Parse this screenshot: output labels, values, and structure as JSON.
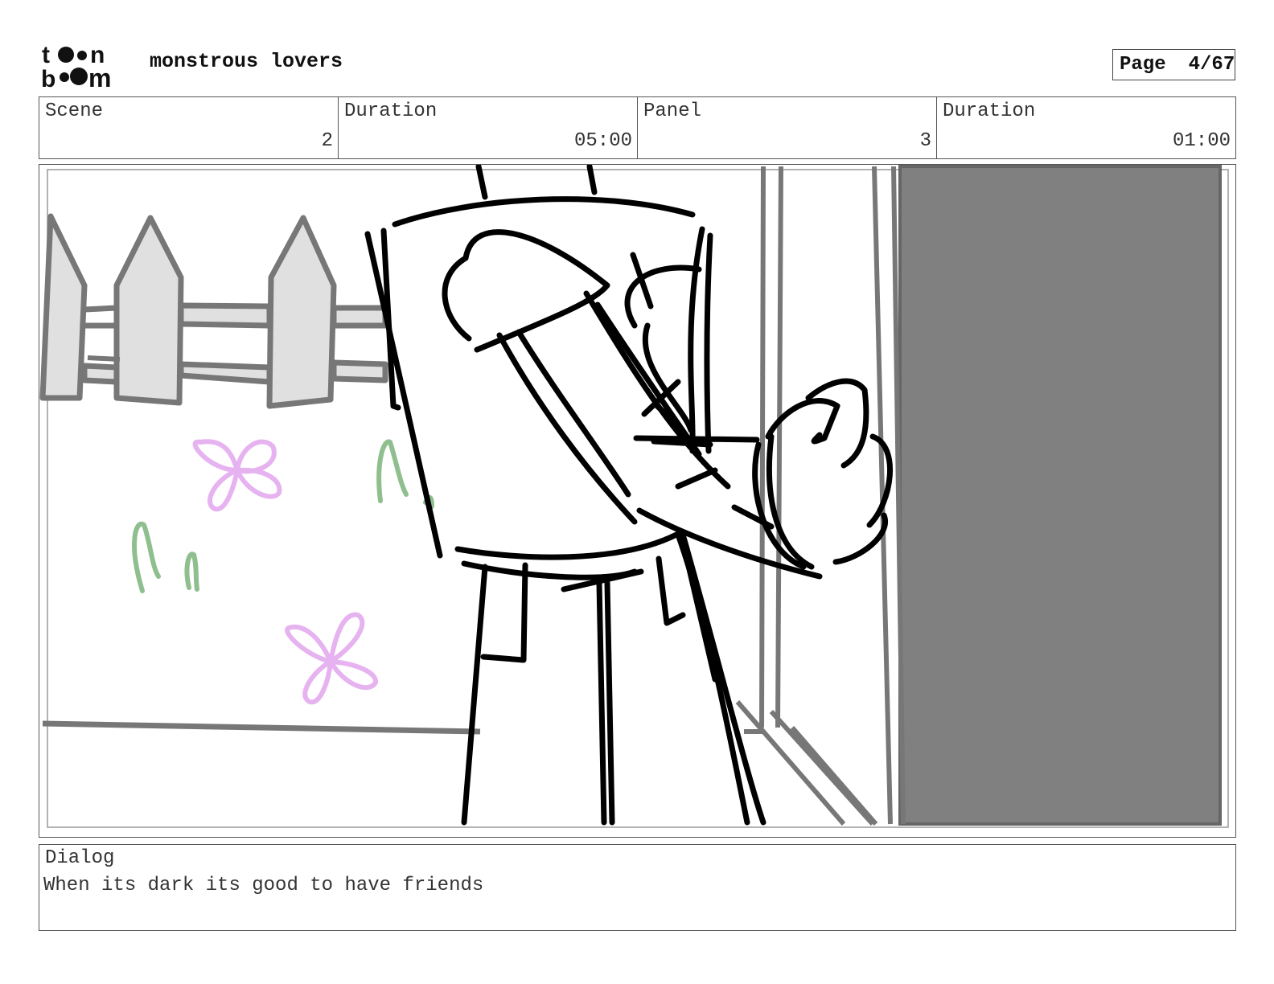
{
  "header": {
    "logo_text": "toon boom",
    "project_title": "monstrous lovers",
    "page_label": "Page",
    "page_value": "4/67"
  },
  "info": {
    "scene_label": "Scene",
    "scene_value": "2",
    "scene_duration_label": "Duration",
    "scene_duration_value": "05:00",
    "panel_label": "Panel",
    "panel_value": "3",
    "panel_duration_label": "Duration",
    "panel_duration_value": "01:00"
  },
  "panel_image": {
    "description_icon": "storyboard-sketch"
  },
  "dialog": {
    "label": "Dialog",
    "text": "When its dark its good to have friends"
  }
}
